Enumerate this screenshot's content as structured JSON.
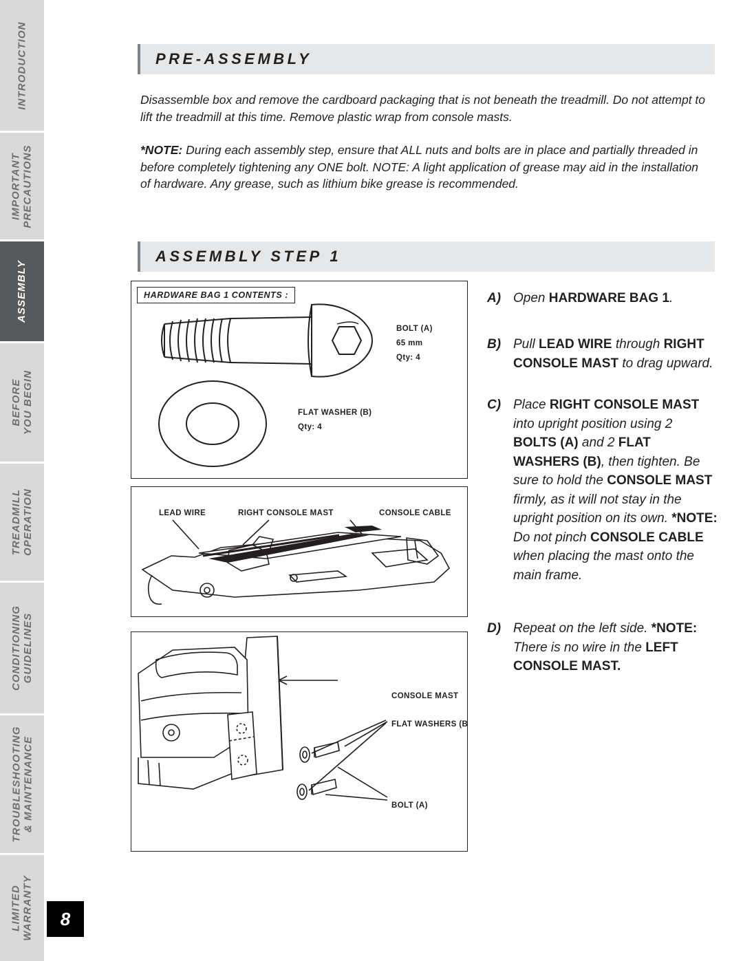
{
  "page": {
    "number": "8"
  },
  "side_nav": {
    "items": [
      {
        "name": "introduction",
        "lines": [
          "INTRODUCTION"
        ],
        "active": false
      },
      {
        "name": "important-precautions",
        "lines": [
          "IMPORTANT",
          "PRECAUTIONS"
        ],
        "active": false
      },
      {
        "name": "assembly",
        "lines": [
          "ASSEMBLY"
        ],
        "active": true
      },
      {
        "name": "before-you-begin",
        "lines": [
          "BEFORE",
          "YOU BEGIN"
        ],
        "active": false
      },
      {
        "name": "treadmill-operation",
        "lines": [
          "TREADMILL",
          "OPERATION"
        ],
        "active": false
      },
      {
        "name": "conditioning-guidelines",
        "lines": [
          "CONDITIONING",
          "GUIDELINES"
        ],
        "active": false
      },
      {
        "name": "troubleshooting-maintenance",
        "lines": [
          "TROUBLESHOOTING",
          "& MAINTENANCE"
        ],
        "active": false
      },
      {
        "name": "limited-warranty",
        "lines": [
          "LIMITED",
          "WARRANTY"
        ],
        "active": false
      }
    ]
  },
  "sections": {
    "pre_assembly": {
      "heading": "PRE-ASSEMBLY",
      "paragraph_1": "Disassemble box and remove the cardboard packaging that is not beneath the treadmill. Do not attempt to lift the treadmill at this time. Remove plastic wrap from console masts.",
      "paragraph_2_note_label": "*NOTE:",
      "paragraph_2": " During each assembly step, ensure that ALL nuts and bolts are in place and partially threaded in before completely tightening any ONE bolt. NOTE: A light application of grease may aid in the installation of hardware. Any grease, such as lithium bike grease is recommended."
    },
    "assembly_step": {
      "heading_prefix": "ASSEMBLY",
      "heading_suffix": "STEP",
      "heading_number": "1"
    }
  },
  "hardware_bag": {
    "title": "HARDWARE BAG 1 CONTENTS :",
    "items": [
      {
        "name": "BOLT (A)",
        "spec": "65 mm",
        "qty": "Qty: 4"
      },
      {
        "name": "FLAT WASHER (B)",
        "spec": "",
        "qty": "Qty: 4"
      }
    ]
  },
  "figures": {
    "mast_diagram": {
      "labels": [
        "LEAD WIRE",
        "RIGHT CONSOLE MAST",
        "CONSOLE CABLE"
      ]
    },
    "bolt_diagram": {
      "labels": [
        "CONSOLE MAST",
        "FLAT WASHERS (B)",
        "BOLT (A)"
      ]
    }
  },
  "instructions": [
    {
      "letter": "A)",
      "html": "Open <b>HARDWARE BAG 1</b>."
    },
    {
      "letter": "B)",
      "html": "Pull <b>LEAD WIRE</b> through <b>RIGHT CONSOLE MAST</b> to drag upward."
    },
    {
      "letter": "C)",
      "html": "Place <b>RIGHT CONSOLE MAST</b> into upright position using 2 <b>BOLTS (A)</b> and 2 <b>FLAT WASHERS (B)</b>, then tighten. Be sure to hold the <b>CONSOLE MAST</b> firmly, as it will not stay in the upright position on its own. <b>*NOTE:</b> Do not pinch <b>CONSOLE CABLE</b> when placing the mast onto the main frame."
    },
    {
      "letter": "D)",
      "html": "Repeat on the left side. <b>*NOTE:</b> There is no wire in the <b>LEFT CONSOLE MAST.</b>"
    }
  ],
  "colors": {
    "tab_inactive_bg": "#d9d9d9",
    "tab_active_bg": "#58595b",
    "bar_bg": "#e6e7e8",
    "bar_accent": "#808285",
    "text": "#231f20"
  }
}
